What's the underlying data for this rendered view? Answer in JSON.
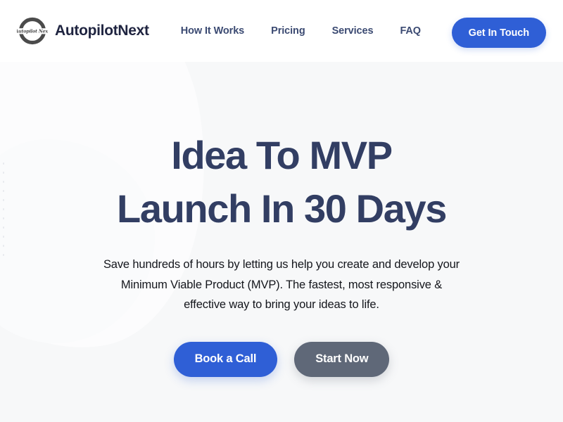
{
  "header": {
    "brand": {
      "name": "AutopilotNext",
      "logo_icon": "autopilotnext-ring-logo",
      "logo_script_text": "Autopilot Next"
    },
    "nav": [
      {
        "label": "How It Works"
      },
      {
        "label": "Pricing"
      },
      {
        "label": "Services"
      },
      {
        "label": "FAQ"
      }
    ],
    "cta": {
      "label": "Get In Touch"
    }
  },
  "hero": {
    "title_line_1": "Idea To MVP",
    "title_line_2": "Launch In 30 Days",
    "subtitle": "Save hundreds of hours by letting us help you create and develop your Minimum Viable Product (MVP). The fastest, most responsive & effective way to bring your ideas to life.",
    "primary_button": "Book a Call",
    "secondary_button": "Start Now"
  },
  "colors": {
    "accent_blue": "#2f5fd6",
    "secondary_gray": "#5f6878",
    "heading_navy": "#323e63",
    "nav_link": "#3b4a72",
    "brand_text": "#1f2440",
    "header_bg": "#ffffff",
    "hero_bg": "#f7f8f9",
    "body_text": "#14161c",
    "logo_ring": "#4b4b4b"
  }
}
